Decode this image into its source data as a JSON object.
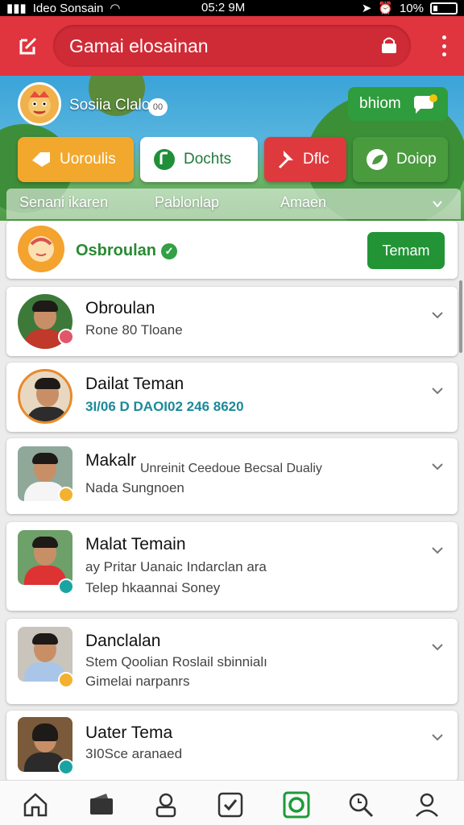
{
  "status_bar": {
    "carrier": "Ideo Sonsain",
    "time": "05:2 9M",
    "battery": "10%"
  },
  "header": {
    "search_text": "Gamai elosainan"
  },
  "profile": {
    "name": "Sosiia Clalo",
    "badge": "00",
    "button_label": "bhiom"
  },
  "actions": [
    {
      "label": "Uoroulis",
      "color": "#f2a82c"
    },
    {
      "label": "Dochts",
      "color": "#ffffff"
    },
    {
      "label": "Dflc",
      "color": "#de3a3e"
    },
    {
      "label": "Doiop",
      "color": "#4a9a3e"
    }
  ],
  "tabs": [
    "Senani ikaren",
    "Pablonlap",
    "Amaen"
  ],
  "request": {
    "name": "Osbroulan",
    "button_label": "Temam"
  },
  "friends": [
    {
      "name": "Obroulan",
      "line1": "Rone 80 Tloane",
      "line2": ""
    },
    {
      "name": "Dailat Teman",
      "line1": "3I/06 D DAOI02 246 8620",
      "line2": ""
    },
    {
      "name": "Makalr",
      "inline": "Unreinit Ceedoue Becsal Dualiy",
      "line1": "Nada Sungnoen",
      "line2": ""
    },
    {
      "name": "Malat Temain",
      "line1": "ay Pritar Uanaic Indarclan ara",
      "line2": "Telep hkaannai Soney"
    },
    {
      "name": "Danclalan",
      "line1": "Stem Qoolian Roslail sbinnialı",
      "line2": "Gimelai narpanrs"
    },
    {
      "name": "Uater Tema",
      "line1": "3I0Sce aranaed",
      "line2": ""
    }
  ],
  "colors": {
    "header": "#e0343f",
    "accent_green": "#229436"
  }
}
